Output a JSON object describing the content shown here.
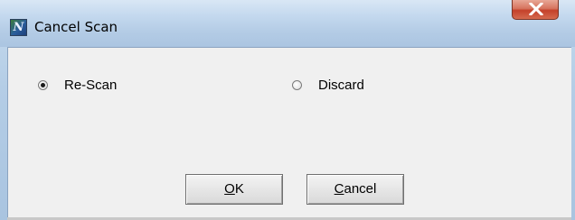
{
  "window": {
    "title": "Cancel Scan",
    "icon": "app-logo-n-icon",
    "close_icon": "close-icon"
  },
  "options": [
    {
      "label": "Re-Scan",
      "selected": true
    },
    {
      "label": "Discard",
      "selected": false
    }
  ],
  "buttons": {
    "ok": {
      "mnemonic": "O",
      "rest": "K"
    },
    "cancel": {
      "mnemonic": "C",
      "rest": "ancel"
    }
  },
  "colors": {
    "titlebar": "#b4cde6",
    "close": "#c4412a",
    "dialog_bg": "#f0f0f0"
  }
}
